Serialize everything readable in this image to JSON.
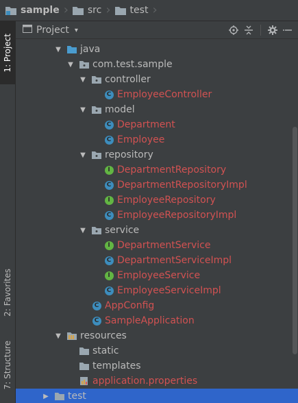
{
  "breadcrumb": {
    "items": [
      {
        "label": "sample",
        "icon": "module-folder-icon"
      },
      {
        "label": "src",
        "icon": "folder-icon"
      },
      {
        "label": "test",
        "icon": "folder-icon"
      }
    ]
  },
  "stripe": {
    "project": "1: Project",
    "favorites": "2: Favorites",
    "structure": "7: Structure"
  },
  "toolwindow": {
    "title": "Project",
    "dropdown": "▾"
  },
  "tree": [
    {
      "label": "java",
      "kind": "source-folder",
      "depth": 0,
      "expanded": true
    },
    {
      "label": "com.test.sample",
      "kind": "package",
      "depth": 1,
      "expanded": true
    },
    {
      "label": "controller",
      "kind": "package",
      "depth": 2,
      "expanded": true
    },
    {
      "label": "EmployeeController",
      "kind": "class",
      "depth": 3
    },
    {
      "label": "model",
      "kind": "package",
      "depth": 2,
      "expanded": true
    },
    {
      "label": "Department",
      "kind": "class",
      "depth": 3
    },
    {
      "label": "Employee",
      "kind": "class",
      "depth": 3
    },
    {
      "label": "repository",
      "kind": "package",
      "depth": 2,
      "expanded": true
    },
    {
      "label": "DepartmentRepository",
      "kind": "interface",
      "depth": 3
    },
    {
      "label": "DepartmentRepositoryImpl",
      "kind": "class",
      "depth": 3
    },
    {
      "label": "EmployeeRepository",
      "kind": "interface",
      "depth": 3
    },
    {
      "label": "EmployeeRepositoryImpl",
      "kind": "class",
      "depth": 3
    },
    {
      "label": "service",
      "kind": "package",
      "depth": 2,
      "expanded": true
    },
    {
      "label": "DepartmentService",
      "kind": "interface",
      "depth": 3
    },
    {
      "label": "DepartmentServiceImpl",
      "kind": "class",
      "depth": 3
    },
    {
      "label": "EmployeeService",
      "kind": "interface",
      "depth": 3
    },
    {
      "label": "EmployeeServiceImpl",
      "kind": "class",
      "depth": 3
    },
    {
      "label": "AppConfig",
      "kind": "class",
      "depth": 2
    },
    {
      "label": "SampleApplication",
      "kind": "spring-class",
      "depth": 2
    },
    {
      "label": "resources",
      "kind": "resource-folder",
      "depth": 0,
      "expanded": true
    },
    {
      "label": "static",
      "kind": "folder",
      "depth": 1
    },
    {
      "label": "templates",
      "kind": "folder",
      "depth": 1
    },
    {
      "label": "application.properties",
      "kind": "properties",
      "depth": 1
    },
    {
      "label": "test",
      "kind": "folder",
      "depth": -1,
      "expanded": false,
      "selected": true
    }
  ],
  "colors": {
    "background": "#3c3f41",
    "selection": "#2f65ca",
    "modified_file": "#d25252",
    "class_icon": "#3d8dbd",
    "interface_icon": "#62b543"
  }
}
